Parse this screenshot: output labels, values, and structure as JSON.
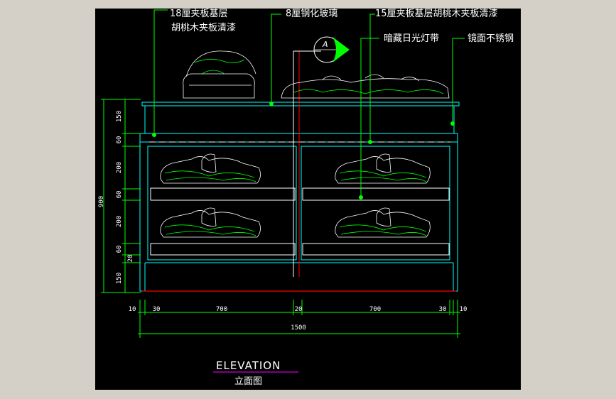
{
  "colors": {
    "background": "#000000",
    "frame": "#00ffff",
    "clothing": "#00ff00",
    "leader": "#00ff00",
    "dimension": "#00ff00",
    "floor_line": "#ff0000",
    "title_underline": "#ff00ff",
    "text": "#ffffff"
  },
  "annotations": {
    "a1_line1": "18厘夹板基层",
    "a1_line2": "胡桃木夹板清漆",
    "a2": "8厘钢化玻璃",
    "a3": "15厘夹板基层胡桃木夹板清漆",
    "a4": "暗藏日光灯带",
    "a5": "镜面不锈钢"
  },
  "section_marker": {
    "letter": "A"
  },
  "dimensions": {
    "vertical_total": "900",
    "vertical_segments": [
      "150",
      "60",
      "200",
      "60",
      "200",
      "60",
      "20",
      "150"
    ],
    "horizontal_segments": [
      "10",
      "30",
      "700",
      "20",
      "700",
      "30",
      "10"
    ],
    "horizontal_total": "1500"
  },
  "title": {
    "english": "ELEVATION",
    "chinese": "立面图"
  }
}
